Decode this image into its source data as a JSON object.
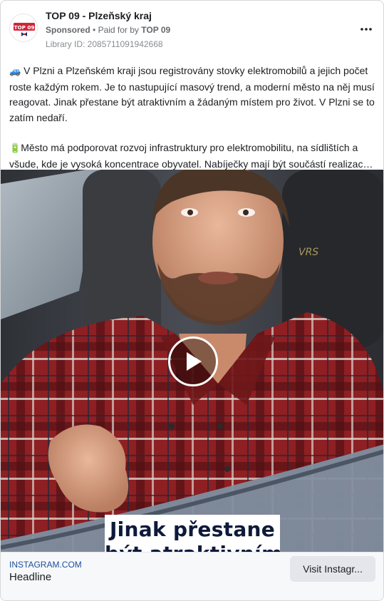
{
  "header": {
    "page_name": "TOP 09 - Plzeňský kraj",
    "sponsored_label": "Sponsored",
    "separator": "•",
    "paid_for_prefix": "Paid for by",
    "paid_for_by": "TOP 09",
    "library_id": "Library ID: 2085711091942668",
    "avatar_logo_text": "TOP 09",
    "more_icon": "more-horizontal-icon"
  },
  "body": {
    "paragraph1_emoji": "🚙",
    "paragraph1": "V Plzni a Plzeňském kraji jsou registrovány stovky elektromobilů a jejich počet roste každým rokem. Je to nastupující masový trend, a moderní město na něj musí reagovat. Jinak přestane být atraktivním a žádaným místem pro život. V Plzni se to zatím nedaří.",
    "paragraph2_emoji": "🔋",
    "paragraph2": "Město má podporovat rozvoj infrastruktury pro elektromobilitu, na sídlištích a všude, kde je vysoká koncentrace obyvatel. Nabíječky mají být součástí realizace …"
  },
  "media": {
    "type": "video",
    "play_icon": "play-icon",
    "caption_line1": "Jinak přestane",
    "caption_line2": "být atraktivním"
  },
  "footer": {
    "link_domain": "INSTAGRAM.COM",
    "headline": "Headline",
    "cta_label": "Visit Instagr..."
  },
  "colors": {
    "accent_link": "#1b4e9b",
    "cta_bg": "#e4e6eb",
    "logo_red": "#d0263a",
    "logo_navy": "#1d2b6b"
  }
}
